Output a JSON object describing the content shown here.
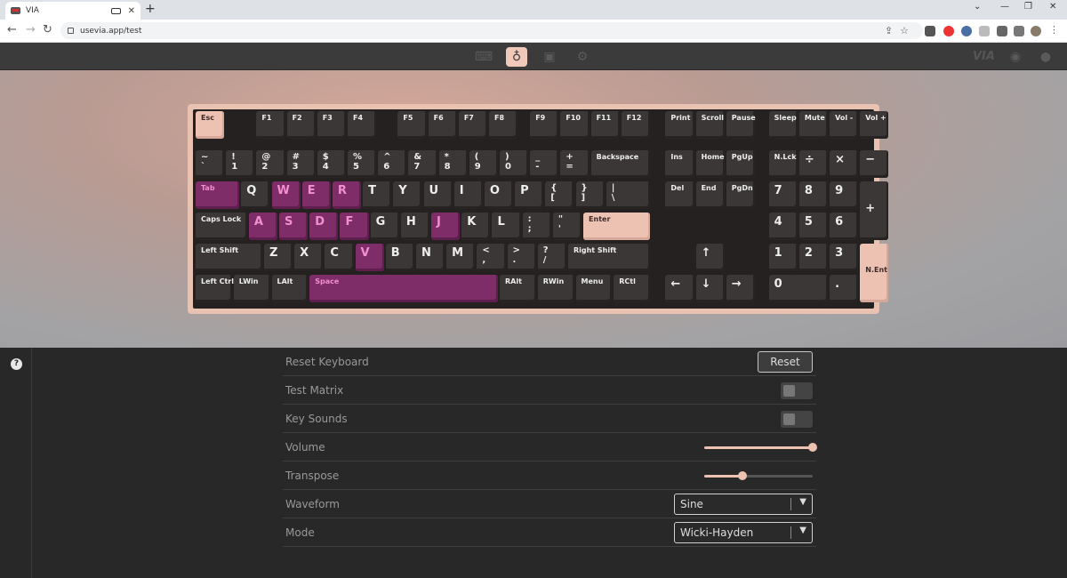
{
  "browser": {
    "tab_title": "VIA",
    "url": "usevia.app/test",
    "new_tab": "+",
    "close": "✕",
    "min": "—",
    "restore": "❐",
    "winclose": "✕"
  },
  "nav": {
    "icons": [
      "keyboard-icon",
      "stethoscope-icon",
      "design-icon",
      "settings-icon"
    ],
    "active": "stethoscope-icon",
    "brand": "VIA"
  },
  "colors": {
    "accent": "#eec2b3",
    "pressed": "#7f2d68",
    "case": "#e9c2b2",
    "keycap": "#3a3736"
  },
  "keyboard": {
    "keys": [
      {
        "l": "Esc",
        "s": "peach"
      },
      {
        "l": "F1"
      },
      {
        "l": "F2"
      },
      {
        "l": "F3"
      },
      {
        "l": "F4"
      },
      {
        "l": "F5"
      },
      {
        "l": "F6"
      },
      {
        "l": "F7"
      },
      {
        "l": "F8"
      },
      {
        "l": "F9"
      },
      {
        "l": "F10"
      },
      {
        "l": "F11"
      },
      {
        "l": "F12"
      },
      {
        "l": "Print"
      },
      {
        "l": "Scroll"
      },
      {
        "l": "Pause"
      },
      {
        "l": "Sleep"
      },
      {
        "l": "Mute"
      },
      {
        "l": "Vol -"
      },
      {
        "l": "Vol +"
      },
      {
        "l": "~\n`"
      },
      {
        "l": "!\n1"
      },
      {
        "l": "@\n2"
      },
      {
        "l": "#\n3"
      },
      {
        "l": "$\n4"
      },
      {
        "l": "%\n5"
      },
      {
        "l": "^\n6"
      },
      {
        "l": "&\n7"
      },
      {
        "l": "*\n8"
      },
      {
        "l": "(\n9"
      },
      {
        "l": ")\n0"
      },
      {
        "l": "_\n-"
      },
      {
        "l": "+\n="
      },
      {
        "l": "Backspace"
      },
      {
        "l": "Ins"
      },
      {
        "l": "Home"
      },
      {
        "l": "PgUp"
      },
      {
        "l": "N.Lck"
      },
      {
        "l": "÷"
      },
      {
        "l": "×"
      },
      {
        "l": "−"
      },
      {
        "l": "Tab",
        "s": "pink"
      },
      {
        "l": "Q"
      },
      {
        "l": "W",
        "s": "pink"
      },
      {
        "l": "E",
        "s": "pink"
      },
      {
        "l": "R",
        "s": "pink"
      },
      {
        "l": "T"
      },
      {
        "l": "Y"
      },
      {
        "l": "U"
      },
      {
        "l": "I"
      },
      {
        "l": "O"
      },
      {
        "l": "P"
      },
      {
        "l": "{\n["
      },
      {
        "l": "}\n]"
      },
      {
        "l": "|\n\\"
      },
      {
        "l": "Del"
      },
      {
        "l": "End"
      },
      {
        "l": "PgDn"
      },
      {
        "l": "7"
      },
      {
        "l": "8"
      },
      {
        "l": "9"
      },
      {
        "l": "+"
      },
      {
        "l": "Caps Lock"
      },
      {
        "l": "A",
        "s": "pink"
      },
      {
        "l": "S",
        "s": "pink"
      },
      {
        "l": "D",
        "s": "pink"
      },
      {
        "l": "F",
        "s": "pink"
      },
      {
        "l": "G"
      },
      {
        "l": "H"
      },
      {
        "l": "J",
        "s": "pink"
      },
      {
        "l": "K"
      },
      {
        "l": "L"
      },
      {
        "l": ":\n;"
      },
      {
        "l": "\"\n'"
      },
      {
        "l": "Enter",
        "s": "peach"
      },
      {
        "l": "4"
      },
      {
        "l": "5"
      },
      {
        "l": "6"
      },
      {
        "l": "Left Shift"
      },
      {
        "l": "Z"
      },
      {
        "l": "X"
      },
      {
        "l": "C"
      },
      {
        "l": "V",
        "s": "pink"
      },
      {
        "l": "B"
      },
      {
        "l": "N"
      },
      {
        "l": "M"
      },
      {
        "l": "<\n,"
      },
      {
        "l": ">\n."
      },
      {
        "l": "?\n/"
      },
      {
        "l": "Right Shift"
      },
      {
        "l": "↑"
      },
      {
        "l": "1"
      },
      {
        "l": "2"
      },
      {
        "l": "3"
      },
      {
        "l": "N.Ent",
        "s": "peach"
      },
      {
        "l": "Left Ctrl"
      },
      {
        "l": "LWin"
      },
      {
        "l": "LAlt"
      },
      {
        "l": "Space",
        "s": "pink"
      },
      {
        "l": "RAlt"
      },
      {
        "l": "RWin"
      },
      {
        "l": "Menu"
      },
      {
        "l": "RCtl"
      },
      {
        "l": "←"
      },
      {
        "l": "↓"
      },
      {
        "l": "→"
      },
      {
        "l": "0"
      },
      {
        "l": "."
      }
    ]
  },
  "settings": {
    "reset_label": "Reset Keyboard",
    "reset_button": "Reset",
    "test_matrix_label": "Test Matrix",
    "test_matrix_on": false,
    "key_sounds_label": "Key Sounds",
    "key_sounds_on": false,
    "volume_label": "Volume",
    "volume_value": 1.0,
    "transpose_label": "Transpose",
    "transpose_value": 0.35,
    "waveform_label": "Waveform",
    "waveform_value": "Sine",
    "mode_label": "Mode",
    "mode_value": "Wicki-Hayden"
  }
}
